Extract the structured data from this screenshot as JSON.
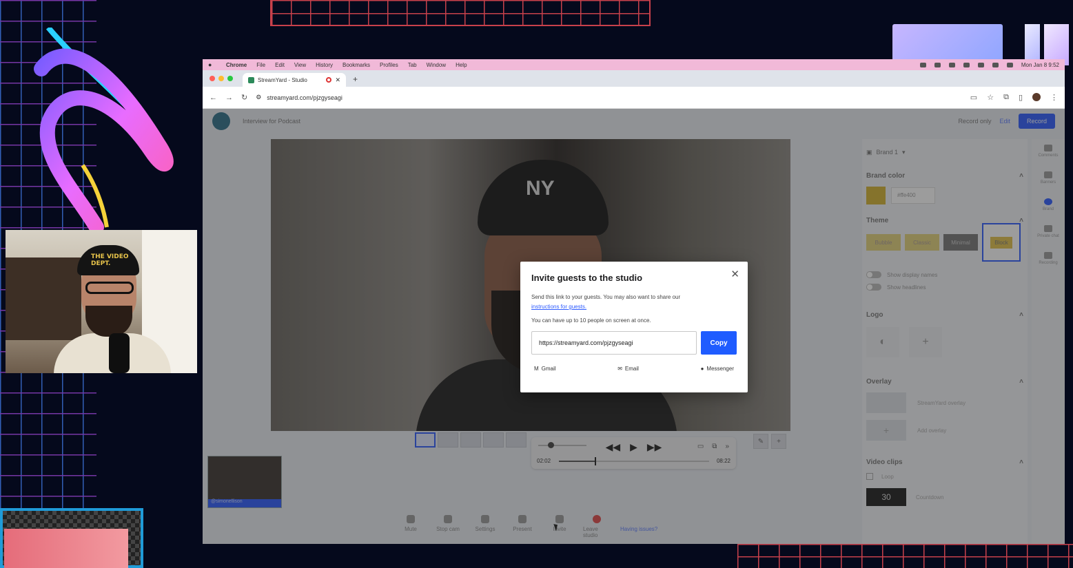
{
  "macos_menu": {
    "app": "Chrome",
    "items": [
      "File",
      "Edit",
      "View",
      "History",
      "Bookmarks",
      "Profiles",
      "Tab",
      "Window",
      "Help"
    ],
    "clock": "Mon Jan 8  9:52"
  },
  "browser": {
    "tab_title": "StreamYard - Studio",
    "url": "streamyard.com/pjzgyseagi"
  },
  "studio": {
    "broadcast_title": "Interview for Podcast",
    "record_only": "Record only",
    "edit": "Edit",
    "record_button": "Record",
    "player": {
      "current": "02:02",
      "duration": "08:22",
      "progress": 0.24
    },
    "guest_name": "@simonellison",
    "bottom_tools": [
      "Mute",
      "Stop cam",
      "Settings",
      "Present",
      "Invite",
      "Leave studio"
    ],
    "help": "Having issues?"
  },
  "side_panel": {
    "brand": "Brand 1",
    "brand_color_label": "Brand color",
    "brand_color_hex": "#ffe400",
    "theme_label": "Theme",
    "themes": [
      "Bubble",
      "Classic",
      "Minimal",
      "Block"
    ],
    "toggles": [
      "Show display names",
      "Show headlines"
    ],
    "logo_label": "Logo",
    "overlay_label": "Overlay",
    "overlay_items": [
      "StreamYard overlay",
      "Add overlay"
    ],
    "video_clips_label": "Video clips",
    "loop_label": "Loop",
    "countdown_value": "30",
    "countdown_label": "Countdown"
  },
  "rail": [
    "Comments",
    "Banners",
    "Brand",
    "Private chat",
    "Recording"
  ],
  "modal": {
    "title": "Invite guests to the studio",
    "desc": "Send this link to your guests. You may also want to share our",
    "link_text": "instructions for guests.",
    "limit": "You can have up to 10 people on screen at once.",
    "invite_url": "https://streamyard.com/pjzgyseagi",
    "copy": "Copy",
    "share": [
      "Gmail",
      "Email",
      "Messenger"
    ]
  },
  "webcam_cap_text": "THE VIDEO DEPT.",
  "colors": {
    "accent": "#1f5cff",
    "menubar": "#f1b9d8",
    "brand_color": "#d4b430"
  }
}
